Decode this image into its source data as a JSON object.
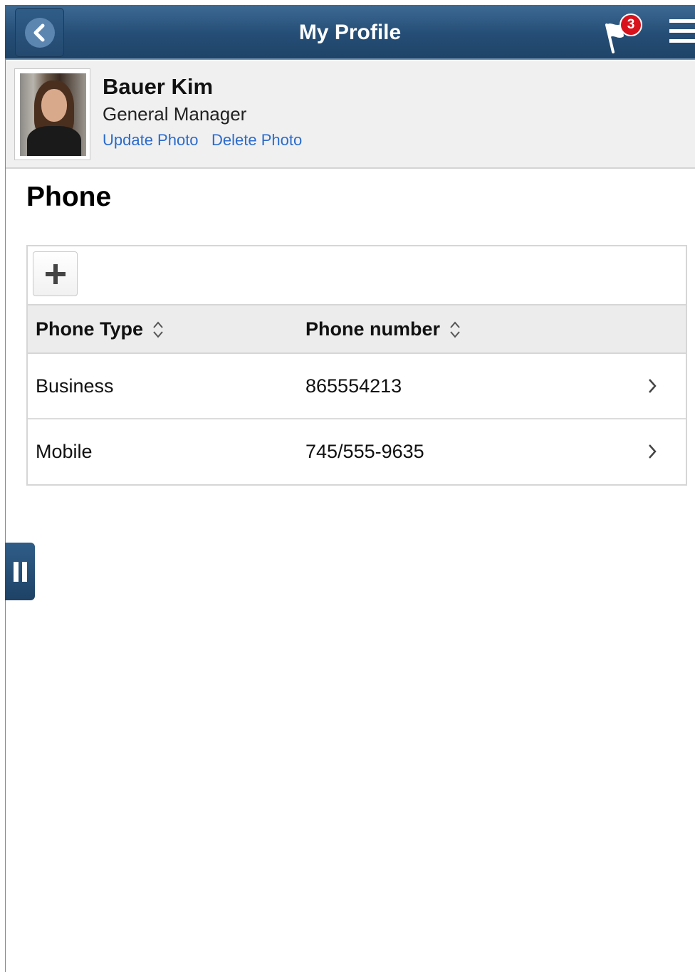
{
  "header": {
    "title": "My Profile",
    "back_icon": "chevron-left-icon",
    "notification_icon": "flag-icon",
    "notification_count": "3",
    "menu_icon": "hamburger-menu-icon"
  },
  "profile": {
    "name": "Bauer Kim",
    "job_title": "General Manager",
    "update_photo_label": "Update Photo",
    "delete_photo_label": "Delete Photo"
  },
  "phone_section": {
    "title": "Phone",
    "add_icon": "plus-icon",
    "columns": [
      "Phone Type",
      "Phone number"
    ],
    "sort_icon": "sort-updown-icon",
    "rows": [
      {
        "type": "Business",
        "number": "865554213"
      },
      {
        "type": "Mobile",
        "number": "745/555-9635"
      }
    ],
    "row_icon": "chevron-right-icon"
  },
  "side_tab": {
    "icon": "pause-icon"
  },
  "colors": {
    "header_blue": "#254d75",
    "link_blue": "#2a6bcc",
    "badge_red": "#d8121c"
  }
}
